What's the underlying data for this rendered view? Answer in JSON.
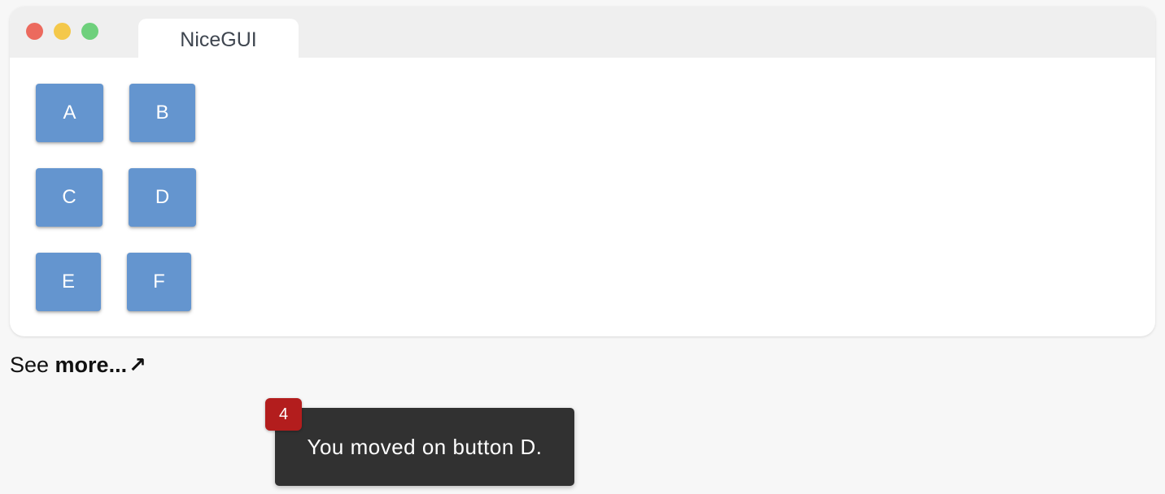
{
  "window": {
    "tab_title": "NiceGUI",
    "traffic_lights": {
      "close_color": "#ec6a5e",
      "minimize_color": "#f4c84a",
      "zoom_color": "#6ed07c"
    }
  },
  "buttons": {
    "a": "A",
    "b": "B",
    "c": "C",
    "d": "D",
    "e": "E",
    "f": "F",
    "color": "#6495cf"
  },
  "footer": {
    "see_text": "See ",
    "more_text": "more...",
    "arrow": "↗"
  },
  "notification": {
    "badge_count": "4",
    "message": "You moved on button D.",
    "badge_color": "#b31d1d",
    "background_color": "#313131"
  }
}
